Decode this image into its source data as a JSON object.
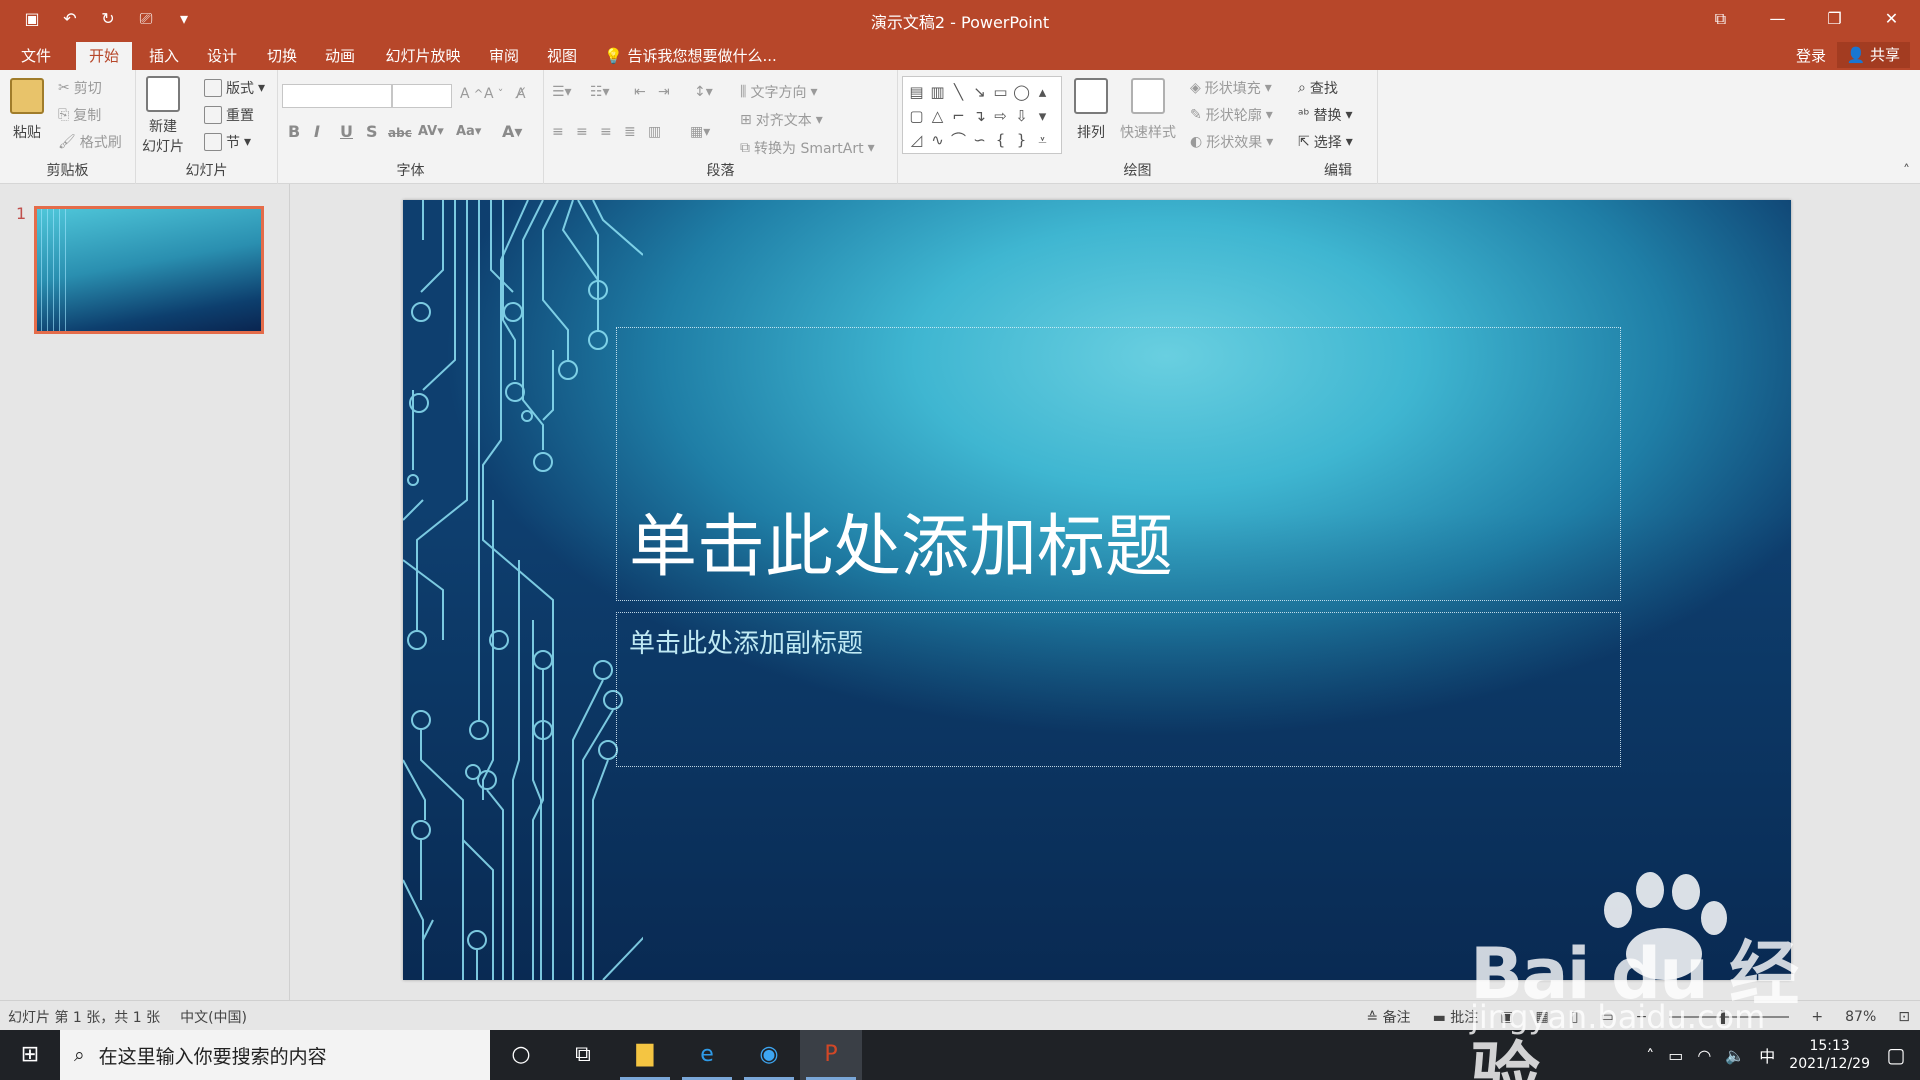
{
  "titlebar": {
    "title": "演示文稿2 - PowerPoint",
    "qat": [
      "save-icon",
      "undo-icon",
      "redo-icon",
      "present-icon",
      "customize-icon"
    ],
    "accent": "#b7472a"
  },
  "tabs": [
    "文件",
    "开始",
    "插入",
    "设计",
    "切换",
    "动画",
    "幻灯片放映",
    "审阅",
    "视图"
  ],
  "active_tab": "开始",
  "tell_me": "告诉我您想要做什么...",
  "account": {
    "login": "登录",
    "share": "共享"
  },
  "ribbon": {
    "clipboard": {
      "label": "剪贴板",
      "paste": "粘贴",
      "cut": "剪切",
      "copy": "复制",
      "format_painter": "格式刷"
    },
    "slides": {
      "label": "幻灯片",
      "new_slide_1": "新建",
      "new_slide_2": "幻灯片",
      "layout": "版式",
      "reset": "重置",
      "section": "节"
    },
    "font": {
      "label": "字体",
      "font_name": "",
      "font_size": ""
    },
    "paragraph": {
      "label": "段落",
      "text_direction": "文字方向",
      "align_text": "对齐文本",
      "smartart": "转换为 SmartArt"
    },
    "drawing": {
      "label": "绘图",
      "arrange": "排列",
      "quick_styles": "快速样式",
      "shape_fill": "形状填充",
      "shape_outline": "形状轮廓",
      "shape_effects": "形状效果"
    },
    "editing": {
      "label": "编辑",
      "find": "查找",
      "replace": "替换",
      "select": "选择"
    }
  },
  "thumbnails": [
    {
      "number": "1"
    }
  ],
  "slide": {
    "title_placeholder": "单击此处添加标题",
    "subtitle_placeholder": "单击此处添加副标题"
  },
  "statusbar": {
    "slide_info": "幻灯片 第 1 张，共 1 张",
    "language": "中文(中国)",
    "notes": "备注",
    "comments": "批注",
    "zoom": "87%"
  },
  "taskbar": {
    "search_placeholder": "在这里输入你要搜索的内容",
    "apps": [
      "cortana-icon",
      "task-view-icon",
      "file-explorer-icon",
      "edge-icon",
      "browser-icon",
      "powerpoint-icon"
    ],
    "ime": "中",
    "time": "15:13",
    "date": "2021/12/29"
  },
  "watermark": {
    "brand": "Bai du 经验",
    "url": "jingyan.baidu.com"
  }
}
